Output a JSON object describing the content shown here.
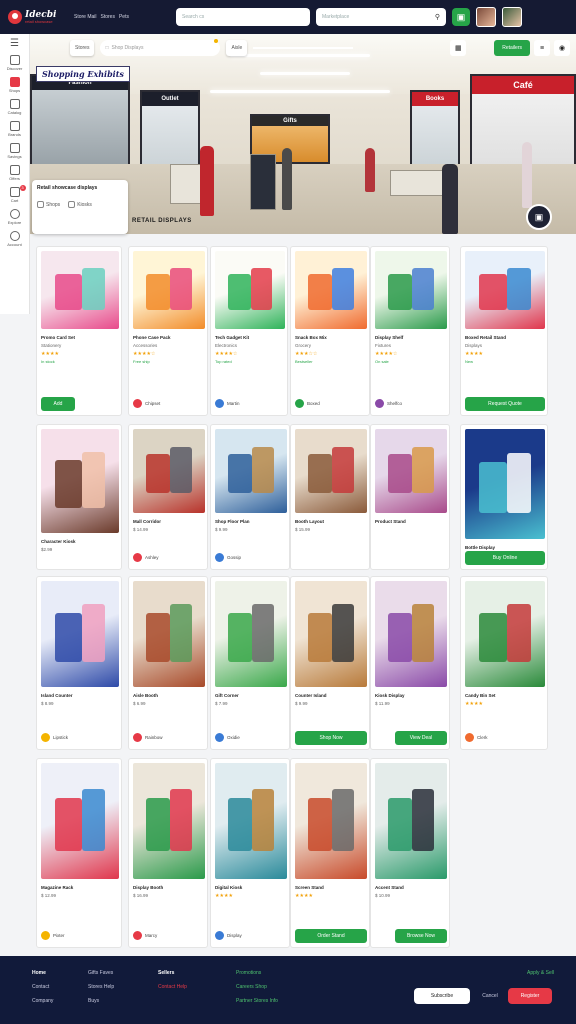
{
  "app": {
    "logo_title": "Idecbi",
    "logo_sub": "retail showcase"
  },
  "topbar": {
    "nav": [
      "Store Mail",
      "Stores",
      "Pets"
    ],
    "search1_placeholder": "Search cs",
    "search2_placeholder": "Marketplace"
  },
  "sidebar": {
    "items": [
      {
        "label": "",
        "icon": "menu-icon"
      },
      {
        "label": "Discover",
        "icon": "store-icon"
      },
      {
        "label": "Shops",
        "icon": "shop-icon",
        "active": true
      },
      {
        "label": "Catalog",
        "icon": "catalog-icon"
      },
      {
        "label": "Brands",
        "icon": "brand-icon"
      },
      {
        "label": "Savings",
        "icon": "tag-icon"
      },
      {
        "label": "Offers",
        "icon": "offer-icon"
      },
      {
        "label": "Cart",
        "icon": "cart-icon",
        "badge": "3"
      },
      {
        "label": "Explore",
        "icon": "explore-icon"
      },
      {
        "label": "Account",
        "icon": "account-icon"
      }
    ]
  },
  "hero": {
    "tab1": "Stores",
    "tab2": "Aisle",
    "search_placeholder": "Shop Displays",
    "green_button": "Retailers",
    "title": "Shopping Exhibits",
    "bottom_label": "RETAIL DISPLAYS",
    "card_title": "Retail showcase displays",
    "chip1": "Shops",
    "chip2": "Kiosks",
    "store_signs": [
      "Fashion",
      "Outlet",
      "Gifts",
      "Books",
      "Café"
    ]
  },
  "cards": [
    {
      "title": "Promo Card Set",
      "sub": "Stationery",
      "stars": "★★★★",
      "meta": "In stock",
      "seller": "",
      "button": "Add"
    },
    {
      "title": "Phone Case Pack",
      "sub": "Accessories",
      "stars": "★★★★☆",
      "meta": "Free ship",
      "seller": "Chipset",
      "button": ""
    },
    {
      "title": "Tech Gadget Kit",
      "sub": "Electronics",
      "stars": "★★★★☆",
      "meta": "Top rated",
      "seller": "Martin",
      "button": ""
    },
    {
      "title": "Snack Box Mix",
      "sub": "Grocery",
      "stars": "★★★☆☆",
      "meta": "Bestseller",
      "seller": "Boxed",
      "button": ""
    },
    {
      "title": "Display Shelf",
      "sub": "Fixtures",
      "stars": "★★★★☆",
      "meta": "On sale",
      "seller": "Shelfco",
      "button": ""
    },
    {
      "title": "Boxed Retail Stand",
      "sub": "Displays",
      "stars": "★★★★",
      "meta": "New",
      "seller": "",
      "button": "Request Quote"
    },
    {
      "title": "Character Kiosk",
      "sub": "$2.99",
      "stars": "",
      "meta": "",
      "seller": "",
      "button": ""
    },
    {
      "title": "Mall Corridor",
      "sub": "$ 14.99",
      "stars": "",
      "meta": "",
      "seller": "Ashley",
      "button": ""
    },
    {
      "title": "Shop Floor Plan",
      "sub": "$ 9.99",
      "stars": "",
      "meta": "",
      "seller": "Gossip",
      "button": ""
    },
    {
      "title": "Booth Layout",
      "sub": "$ 15.99",
      "stars": "",
      "meta": "",
      "seller": "",
      "button": ""
    },
    {
      "title": "Product Stand",
      "sub": "",
      "stars": "",
      "meta": "",
      "seller": "",
      "button": ""
    },
    {
      "title": "Bottle Display",
      "sub": "$ 10.99",
      "stars": "",
      "meta": "",
      "seller": "",
      "button": "Buy Online"
    },
    {
      "title": "Island Counter",
      "sub": "$ 8.99",
      "stars": "",
      "meta": "",
      "seller": "Lipstick",
      "button": ""
    },
    {
      "title": "Aisle Booth",
      "sub": "$ 6.99",
      "stars": "",
      "meta": "",
      "seller": "Rainbow",
      "button": ""
    },
    {
      "title": "Gift Corner",
      "sub": "$ 7.99",
      "stars": "",
      "meta": "",
      "seller": "Oxidie",
      "button": ""
    },
    {
      "title": "Counter Island",
      "sub": "$ 9.99",
      "stars": "",
      "meta": "",
      "seller": "",
      "button": "Shop Now"
    },
    {
      "title": "Kiosk Display",
      "sub": "$ 11.99",
      "stars": "",
      "meta": "",
      "seller": "",
      "button": "View Deal"
    },
    {
      "title": "Candy Bin Set",
      "sub": "",
      "stars": "★★★★",
      "meta": "",
      "seller": "Clerk",
      "button": ""
    },
    {
      "title": "Magazine Rack",
      "sub": "$ 12.99",
      "stars": "",
      "meta": "",
      "seller": "Pixter",
      "button": ""
    },
    {
      "title": "Display Booth",
      "sub": "$ 16.99",
      "stars": "",
      "meta": "",
      "seller": "Marcy",
      "button": ""
    },
    {
      "title": "Digital Kiosk",
      "sub": "",
      "stars": "★★★★",
      "meta": "",
      "seller": "Display",
      "button": ""
    },
    {
      "title": "Screen Stand",
      "sub": "",
      "stars": "★★★★",
      "meta": "",
      "seller": "",
      "button": "Order Stand"
    },
    {
      "title": "Accent Stand",
      "sub": "$ 10.99",
      "stars": "",
      "meta": "",
      "seller": "",
      "button": "Browse Now"
    }
  ],
  "footer": {
    "col1": [
      "Home",
      "Contact",
      "Company"
    ],
    "col2": [
      "Gifts Faves",
      "Stores Help",
      "Buys"
    ],
    "col3": [
      "Sellers",
      "Contact Help"
    ],
    "col4": [
      "Promotions",
      "Careers Shop",
      "Partner Stores Info"
    ],
    "right_text": "Apply & Sell",
    "btn1": "Subscribe",
    "btn2": "Cancel",
    "btn3": "Register"
  },
  "colors": {
    "accent": "#26a448",
    "brand": "#e63946",
    "nav": "#151a33"
  }
}
